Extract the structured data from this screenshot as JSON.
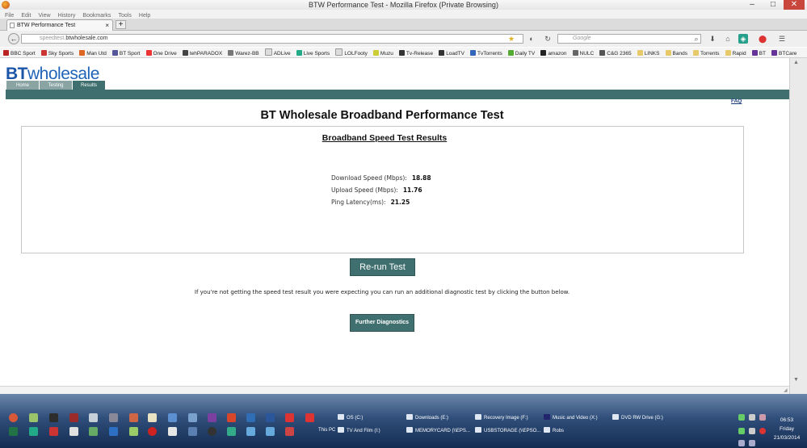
{
  "window": {
    "title": "BTW Performance Test - Mozilla Firefox (Private Browsing)",
    "min": "–",
    "max": "□",
    "close": "✕"
  },
  "menu": [
    "File",
    "Edit",
    "View",
    "History",
    "Bookmarks",
    "Tools",
    "Help"
  ],
  "tab": {
    "label": "BTW Performance Test",
    "close": "×",
    "new": "+"
  },
  "nav": {
    "back": "←",
    "url_host": "speedtest.",
    "url_domain": "btwholesale.com",
    "search_placeholder": "Google"
  },
  "bookmarks": [
    "BBC Sport",
    "Sky Sports",
    "Man Utd",
    "BT Sport",
    "One Drive",
    "tehPARADOX",
    "Warez-BB",
    "ADLive",
    "Live Sports",
    "LOLFooty",
    "Muzu",
    "Tv-Release",
    "LoadTV",
    "TvTorrents",
    "Daily TV",
    "amazon",
    "NULC",
    "C&G 2365",
    "LINKS",
    "Bands",
    "Torrents",
    "Rapid",
    "BT",
    "BTCare"
  ],
  "site": {
    "logo_bt": "BT",
    "logo_rest": "wholesale",
    "tabs": [
      "Home",
      "Testing",
      "Results"
    ],
    "faq": "FAQ",
    "title": "BT Wholesale Broadband Performance Test",
    "results_title": "Broadband Speed Test Results",
    "download_label": "Download Speed (Mbps):",
    "download_value": "18.88",
    "upload_label": "Upload Speed (Mbps):",
    "upload_value": "11.76",
    "ping_label": "Ping Latency(ms):",
    "ping_value": "21.25",
    "rerun_label": "Re-run Test",
    "info_text": "If you're not getting the speed test result you were expecting you can run an additional diagnostic test by clicking the button below.",
    "diagnostics_label": "Further Diagnostics"
  },
  "taskbar": {
    "drives_row1": [
      "OS (C:)",
      "Downloads (E:)",
      "Recovery Image (F:)",
      "Music and Video (X:)",
      "DVD RW Drive (G:)"
    ],
    "drives_row2": [
      "This PC",
      "TV And Film (I:)",
      "MEMORYCARD (\\\\EPS...",
      "USBSTORAGE (\\\\EPSO...",
      "Robs"
    ],
    "time": "06:53",
    "day": "Friday",
    "date": "21/03/2014"
  }
}
